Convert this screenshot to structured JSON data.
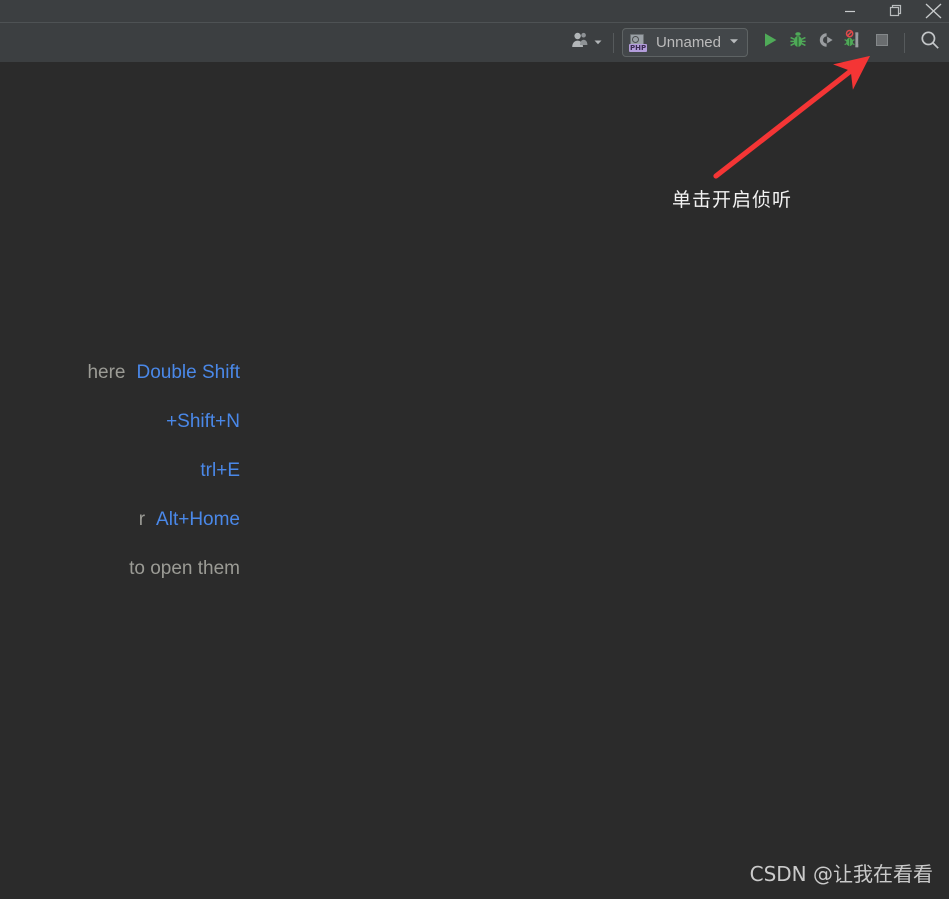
{
  "window": {
    "controls": [
      {
        "name": "minimize",
        "glyph": "minimize-icon",
        "label": "Minimize"
      },
      {
        "name": "restore",
        "glyph": "restore-icon",
        "label": "Restore Down"
      },
      {
        "name": "close",
        "glyph": "close-icon",
        "label": "Close"
      }
    ]
  },
  "toolbar": {
    "account": {
      "icon": "user-account-icon",
      "dropdown_icon": "chevron-down-icon",
      "label": ""
    },
    "run_config": {
      "label": "Unnamed",
      "badge_text": "PHP",
      "dropdown_icon": "chevron-down-icon"
    },
    "actions": [
      {
        "name": "run-button",
        "icon": "run-triangle-icon",
        "label": "Run",
        "enabled": true
      },
      {
        "name": "debug-button",
        "icon": "debug-bug-icon",
        "label": "Debug",
        "enabled": true
      },
      {
        "name": "run-with-coverage",
        "icon": "run-with-coverage-icon",
        "label": "Run with Coverage",
        "enabled": false
      },
      {
        "name": "start-listen-debug",
        "icon": "phone-listen-debug-icon",
        "label": "Start Listening for PHP Debug Connections",
        "enabled": true
      },
      {
        "name": "stop-button",
        "icon": "stop-square-icon",
        "label": "Stop",
        "enabled": false
      },
      {
        "name": "search-everywhere",
        "icon": "search-icon",
        "label": "Search Everywhere",
        "enabled": true
      }
    ]
  },
  "editor": {
    "shortcut_hints": [
      {
        "text": "here",
        "key": "Double Shift"
      },
      {
        "text": "",
        "key": "+Shift+N"
      },
      {
        "text": "",
        "key": "trl+E"
      },
      {
        "text": "r",
        "key": "Alt+Home"
      },
      {
        "text": "to open them",
        "key": ""
      }
    ]
  },
  "annotation": {
    "arrow": "red-arrow-icon",
    "text": "单击开启侦听",
    "color": "#f43535"
  },
  "watermark": {
    "text": "CSDN @让我在看看"
  },
  "colors": {
    "titlebar_bg": "#3c3f41",
    "toolbar_bg": "#3c3f41",
    "editor_bg": "#2b2b2b",
    "hint_text": "#9b9b95",
    "hint_key": "#4a88e8",
    "accent_run": "#59a869",
    "accent_red": "#f43535",
    "php_badge": "#b39ddb"
  }
}
